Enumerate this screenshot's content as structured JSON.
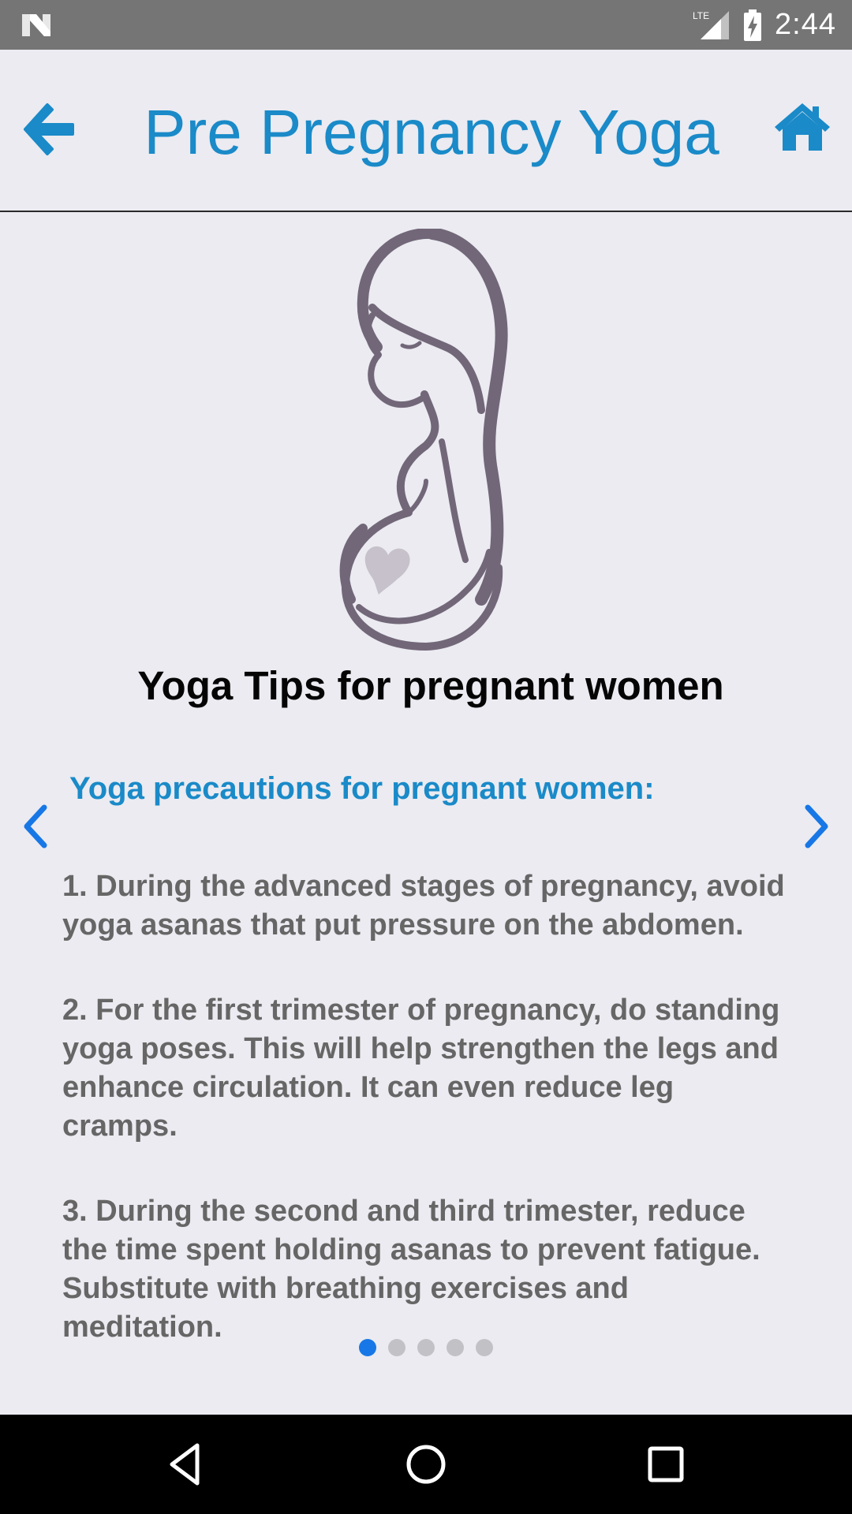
{
  "status_bar": {
    "network": "LTE",
    "time": "2:44"
  },
  "app_bar": {
    "title": "Pre Pregnancy Yoga",
    "back_icon": "arrow-left-icon",
    "home_icon": "home-icon"
  },
  "hero": {
    "image": "pregnant-woman-silhouette"
  },
  "content": {
    "heading": "Yoga Tips for pregnant women",
    "section_title": "Yoga precautions for pregnant women:",
    "tips": [
      "1. During the advanced stages of pregnancy, avoid yoga asanas that put pressure on the abdomen.",
      "2. For the first trimester of pregnancy, do standing yoga poses. This will help strengthen the legs and enhance circulation. It can even reduce leg cramps.",
      "3. During the second and third trimester, reduce the time spent holding asanas to prevent fatigue. Substitute with breathing exercises and meditation."
    ],
    "pager": {
      "pages": 5,
      "current_page": 1,
      "prev_label": "❮",
      "next_label": "❯"
    }
  },
  "colors": {
    "accent": "#1a8ac8",
    "background": "#ebebf1",
    "tip_text": "#666666",
    "dot_active": "#1877e6",
    "dot_inactive": "#c2c2c6"
  }
}
